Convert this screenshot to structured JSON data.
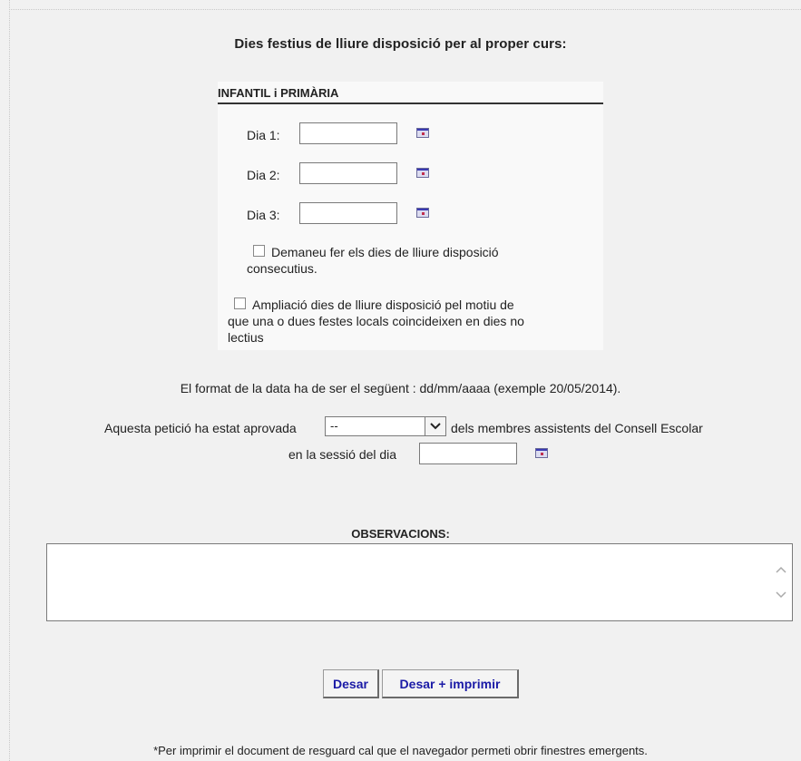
{
  "heading": "Dies festius de lliure disposició per al proper curs:",
  "section": {
    "title": "INFANTIL i PRIMÀRIA",
    "days": [
      {
        "label": "Dia 1:",
        "value": ""
      },
      {
        "label": "Dia 2:",
        "value": ""
      },
      {
        "label": "Dia 3:",
        "value": ""
      }
    ],
    "checkbox_consecutive": {
      "line1": "Demaneu fer els dies de lliure disposició",
      "line2": "consecutius.",
      "checked": false
    },
    "checkbox_extension": {
      "line1": "Ampliació dies de lliure disposició pel motiu de",
      "line2": "que una o dues festes locals coincideixen en dies no",
      "line3": "lectius",
      "checked": false
    }
  },
  "date_format_note": "El format de la data ha de ser el següent : dd/mm/aaaa (exemple 20/05/2014).",
  "approval": {
    "prefix": "Aquesta petició ha estat aprovada",
    "select_value": "--",
    "suffix": "dels membres assistents del Consell Escolar",
    "session_label": "en la sessió del dia",
    "session_value": ""
  },
  "observations": {
    "title": "OBSERVACIONS:",
    "value": ""
  },
  "buttons": {
    "save": "Desar",
    "save_print": "Desar + imprimir"
  },
  "footnote": "*Per imprimir el document de resguard cal que el navegador permeti obrir finestres emergents.",
  "icons": {
    "calendar": "calendar-icon",
    "dropdown": "chevron-down-icon",
    "scroll_up": "scroll-up-icon",
    "scroll_down": "scroll-down-icon"
  },
  "colors": {
    "button_text": "#1a1aa6",
    "page_background": "#f1f1f1",
    "panel_background": "#f9f9f9"
  }
}
